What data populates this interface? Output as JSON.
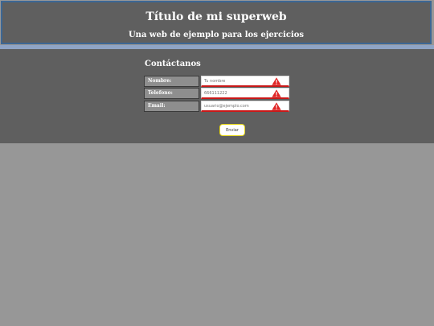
{
  "header": {
    "title": "Título de mi superweb",
    "subtitle": "Una web de ejemplo para los ejercicios"
  },
  "form": {
    "title": "Contáctanos",
    "fields": [
      {
        "label": "Nombre:",
        "placeholder": "Tu nombre",
        "icon": "warning-icon"
      },
      {
        "label": "Telefono:",
        "placeholder": "666111222",
        "icon": "warning-icon"
      },
      {
        "label": "Email:",
        "placeholder": "usuario@ejemplo.com",
        "icon": "warning-icon"
      }
    ],
    "submit_label": "Enviar"
  },
  "colors": {
    "header_bg": "#5f5f5f",
    "header_border": "#3d6794",
    "page_bg": "#979797",
    "error_red": "#c91818",
    "button_border": "#e6d619"
  }
}
